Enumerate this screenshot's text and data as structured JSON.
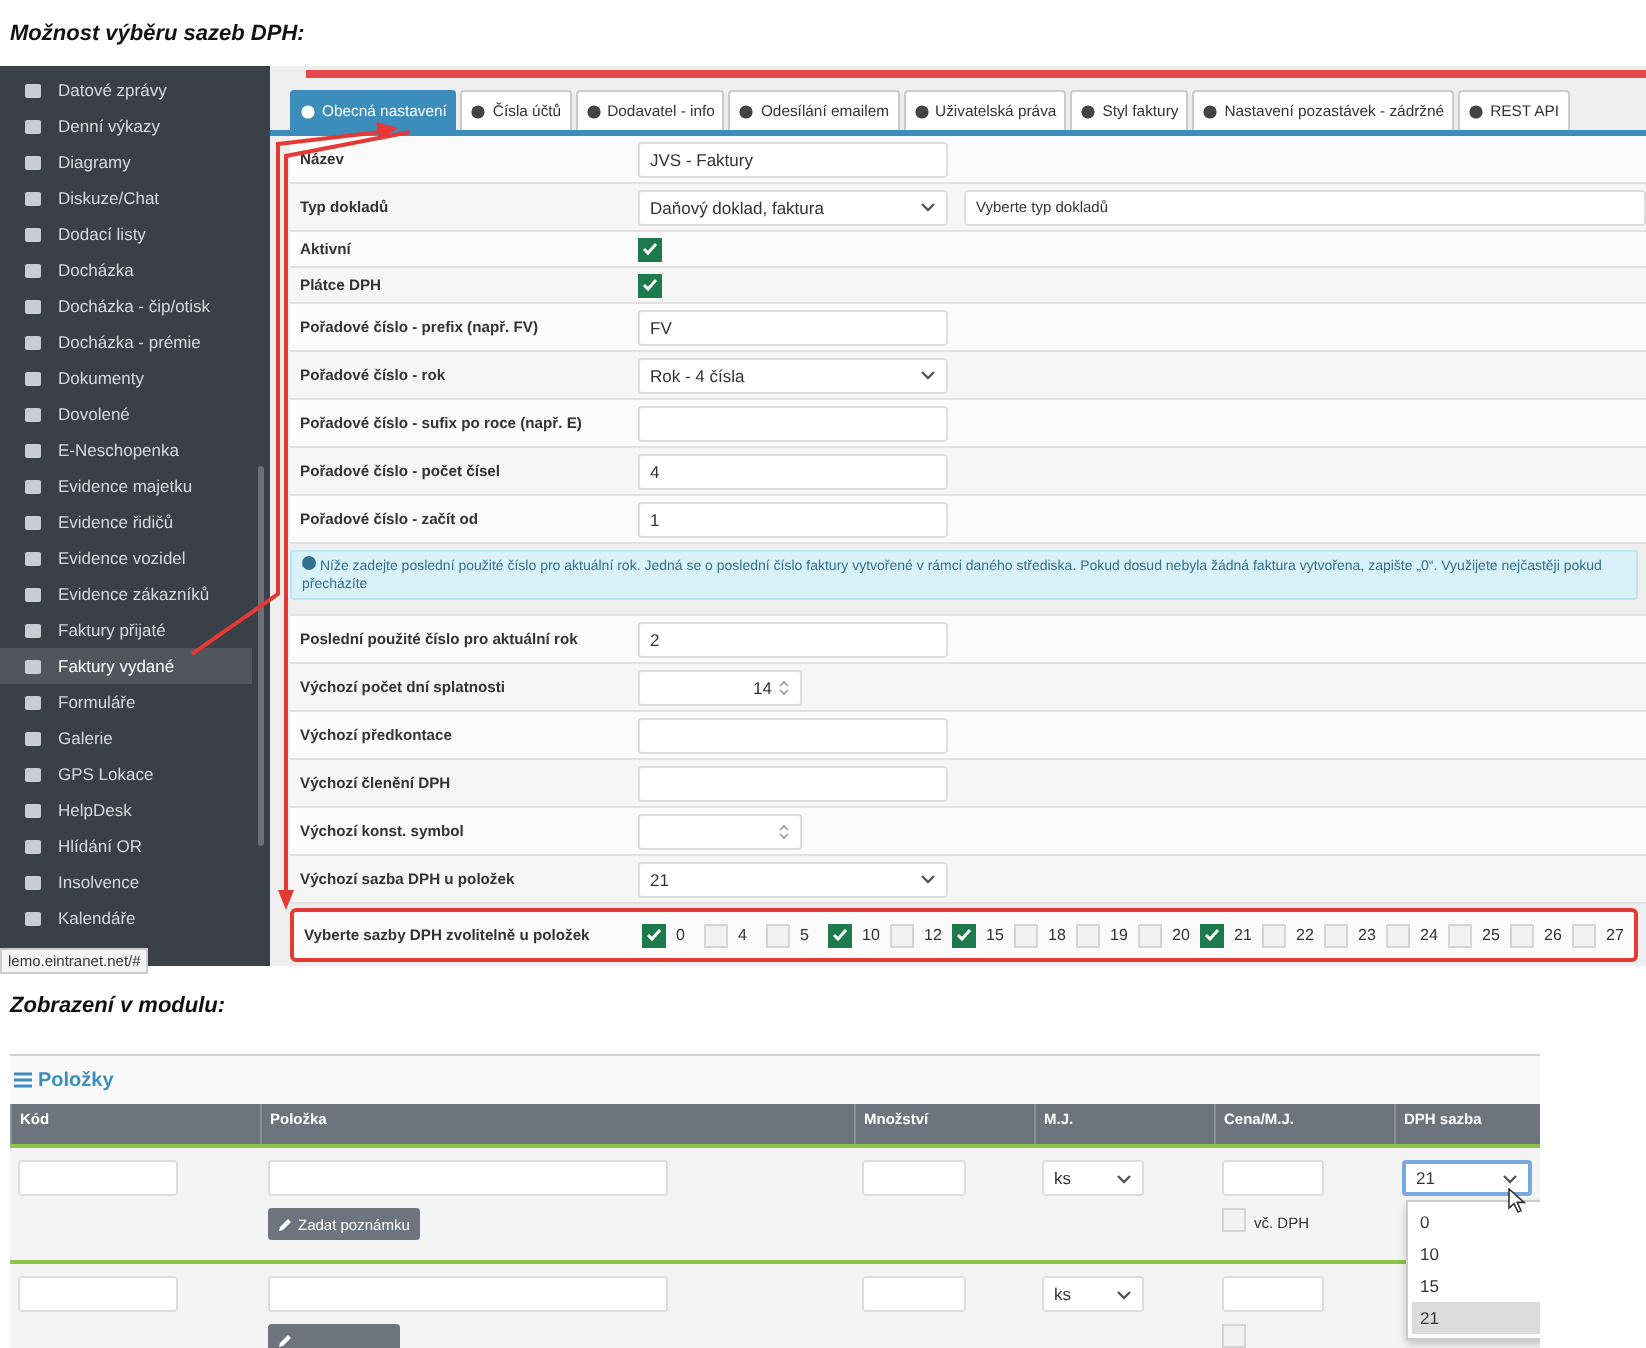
{
  "caption_top": "Možnost výběru sazeb DPH:",
  "sidebar": {
    "items": [
      {
        "label": "Datové zprávy",
        "selected": false
      },
      {
        "label": "Denní výkazy",
        "selected": false
      },
      {
        "label": "Diagramy",
        "selected": false
      },
      {
        "label": "Diskuze/Chat",
        "selected": false
      },
      {
        "label": "Dodací listy",
        "selected": false
      },
      {
        "label": "Docházka",
        "selected": false
      },
      {
        "label": "Docházka - čip/otisk",
        "selected": false
      },
      {
        "label": "Docházka - prémie",
        "selected": false
      },
      {
        "label": "Dokumenty",
        "selected": false
      },
      {
        "label": "Dovolené",
        "selected": false
      },
      {
        "label": "E-Neschopenka",
        "selected": false
      },
      {
        "label": "Evidence majetku",
        "selected": false
      },
      {
        "label": "Evidence řidičů",
        "selected": false
      },
      {
        "label": "Evidence vozidel",
        "selected": false
      },
      {
        "label": "Evidence zákazníků",
        "selected": false
      },
      {
        "label": "Faktury přijaté",
        "selected": false
      },
      {
        "label": "Faktury vydané",
        "selected": true
      },
      {
        "label": "Formuláře",
        "selected": false
      },
      {
        "label": "Galerie",
        "selected": false
      },
      {
        "label": "GPS Lokace",
        "selected": false
      },
      {
        "label": "HelpDesk",
        "selected": false
      },
      {
        "label": "Hlídání OR",
        "selected": false
      },
      {
        "label": "Insolvence",
        "selected": false
      },
      {
        "label": "Kalendáře",
        "selected": false
      }
    ]
  },
  "status_url": "lemo.eintranet.net/#",
  "tabs": [
    {
      "label": "Obecná nastavení",
      "selected": true
    },
    {
      "label": "Čísla účtů",
      "selected": false
    },
    {
      "label": "Dodavatel - info",
      "selected": false
    },
    {
      "label": "Odesílání emailem",
      "selected": false
    },
    {
      "label": "Uživatelská práva",
      "selected": false
    },
    {
      "label": "Styl faktury",
      "selected": false
    },
    {
      "label": "Nastavení pozastávek - zádržné",
      "selected": false
    },
    {
      "label": "REST API",
      "selected": false
    }
  ],
  "form": {
    "rows": [
      {
        "kind": "text",
        "label": "Název",
        "value": "JVS - Faktury"
      },
      {
        "kind": "select",
        "label": "Typ dokladů",
        "value": "Daňový doklad, faktura",
        "extra_select": "Vyberte typ dokladů"
      },
      {
        "kind": "checkbox",
        "label": "Aktivní",
        "checked": true
      },
      {
        "kind": "checkbox",
        "label": "Plátce DPH",
        "checked": true
      },
      {
        "kind": "text",
        "label": "Pořadové číslo - prefix (např. FV)",
        "value": "FV"
      },
      {
        "kind": "select",
        "label": "Pořadové číslo - rok",
        "value": "Rok - 4 čísla"
      },
      {
        "kind": "text",
        "label": "Pořadové číslo - sufix po roce (např. E)"
      },
      {
        "kind": "text",
        "label": "Pořadové číslo - počet čísel",
        "value": "4"
      },
      {
        "kind": "text",
        "label": "Pořadové číslo - začít od",
        "value": "1"
      },
      {
        "kind": "info",
        "text": "Níže zadejte poslední použité číslo pro aktuální rok. Jedná se o poslední číslo faktury vytvořené v rámci daného střediska. Pokud dosud nebyla žádná faktura vytvořena, zapište „0“. Využijete nejčastěji pokud přecházíte"
      },
      {
        "kind": "text",
        "label": "Poslední použité číslo pro aktuální rok",
        "value": "2"
      },
      {
        "kind": "number",
        "label": "Výchozí počet dní splatnosti",
        "value": "14"
      },
      {
        "kind": "text",
        "label": "Výchozí předkontace"
      },
      {
        "kind": "text",
        "label": "Výchozí členění DPH"
      },
      {
        "kind": "number",
        "label": "Výchozí konst. symbol"
      },
      {
        "kind": "select",
        "label": "Výchozí sazba DPH u položek",
        "value": "21"
      },
      {
        "kind": "rates",
        "label": "Vyberte sazby DPH zvolitelně u položek",
        "options": [
          {
            "label": "0",
            "checked": true
          },
          {
            "label": "4",
            "checked": false
          },
          {
            "label": "5",
            "checked": false
          },
          {
            "label": "10",
            "checked": true
          },
          {
            "label": "12",
            "checked": false
          },
          {
            "label": "15",
            "checked": true
          },
          {
            "label": "18",
            "checked": false
          },
          {
            "label": "19",
            "checked": false
          },
          {
            "label": "20",
            "checked": false
          },
          {
            "label": "21",
            "checked": true
          },
          {
            "label": "22",
            "checked": false
          },
          {
            "label": "23",
            "checked": false
          },
          {
            "label": "24",
            "checked": false
          },
          {
            "label": "25",
            "checked": false
          },
          {
            "label": "26",
            "checked": false
          },
          {
            "label": "27",
            "checked": false
          }
        ]
      }
    ]
  },
  "caption_module": "Zobrazení v modulu:",
  "module": {
    "title": "Položky",
    "columns": [
      "Kód",
      "Položka",
      "Množství",
      "M.J.",
      "Cena/M.J.",
      "DPH sazba"
    ],
    "rows": [
      {
        "unit": "ks",
        "vat": "21",
        "note_button": "Zadat poznámku",
        "vat_included": {
          "label": "vč. DPH",
          "checked": false
        }
      },
      {
        "unit": "ks",
        "vat_included": {
          "checked": false
        }
      }
    ],
    "vat_dropdown": {
      "options": [
        {
          "label": "0",
          "selected": false
        },
        {
          "label": "10",
          "selected": false
        },
        {
          "label": "15",
          "selected": false
        },
        {
          "label": "21",
          "selected": true
        }
      ]
    }
  }
}
